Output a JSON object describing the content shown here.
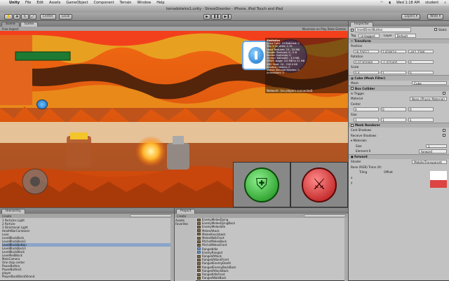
{
  "menubar": {
    "app": "Unity",
    "items": [
      "File",
      "Edit",
      "Assets",
      "GameObject",
      "Component",
      "Terrain",
      "Window",
      "Help"
    ],
    "clock": "Wed 1:18 AM",
    "user": "student"
  },
  "window": {
    "title": "tornadotwins1.unity - StressDisorder - iPhone, iPod Touch and iPad"
  },
  "toolbar": {
    "pivot_label": "Center",
    "space_label": "Local",
    "layers_label": "Layers",
    "layout_label": "Wide"
  },
  "scene_tabs": [
    {
      "label": "Scene"
    },
    {
      "label": "Game"
    }
  ],
  "game_subbar": {
    "left": "Free Aspect",
    "right": "Maximize on Play  Stats  Gizmos"
  },
  "stats_panel": {
    "title": "Statistics",
    "lines": [
      "Draw Calls: 15   Batched: 0",
      "Tris: 2.1k   Verts: 1.7k",
      "Used Textures: 10 - 20 MB",
      "Render Textures: 0 - 0 B",
      "Render Switches: 0",
      "Screen: 640x400 - 3.0 MB",
      "VRAM usage: 3.0 MB to 21 MB",
      "VBO Total: 24 - 218.0 KB",
      "Shadow Casters: 0",
      "Visible Skinned Meshes: 0",
      "Animations: 0"
    ],
    "network": "Network: (no players connected)"
  },
  "hierarchy": {
    "tab": "Hierarchy",
    "create": "Create",
    "items": [
      "1 Particles Light",
      "2 Particle",
      "3 Directional Light",
      "HealthBarContainer",
      "Lava",
      "LevelBlackBack",
      "LevelBlackBack2",
      "LevelBlackButton",
      "LevelBlackBack3",
      "LevelBlackBlock",
      "LevelRedBlock",
      "MainCamera",
      "One stop center",
      "PauseButton",
      "PauseButton2",
      "player",
      "PlayerBackBlockStrand"
    ],
    "selected_index": 7
  },
  "project": {
    "tab": "Project",
    "create": "Create",
    "left_items": [
      "Assets",
      "Favorites"
    ],
    "files": [
      {
        "name": "EnemyMeleeDying",
        "folder": false
      },
      {
        "name": "EnemyMeleeDyingBack",
        "folder": false
      },
      {
        "name": "EnemyMeleeIdle",
        "folder": false
      },
      {
        "name": "MeleeAttack",
        "folder": false
      },
      {
        "name": "MeleeKnockback",
        "folder": false
      },
      {
        "name": "MeleeWalkFront",
        "folder": false
      },
      {
        "name": "PitchstMeleeBack",
        "folder": false
      },
      {
        "name": "PitchstMeleeFront",
        "folder": false
      },
      {
        "name": "RangedIdle",
        "folder": true
      },
      {
        "name": "EnemyRanged",
        "folder": true
      },
      {
        "name": "RangedAttack",
        "folder": false
      },
      {
        "name": "RangedAttackFront",
        "folder": false
      },
      {
        "name": "RangedEnemyDeath",
        "folder": false
      },
      {
        "name": "RangedEnemyBackBack",
        "folder": false
      },
      {
        "name": "RangedAttackBack",
        "folder": false
      },
      {
        "name": "RangedIdleFront",
        "folder": false
      },
      {
        "name": "RangedWalkBack",
        "folder": false
      }
    ]
  },
  "inspector": {
    "tab": "Inspector",
    "object_name": "levelDirectButton",
    "static_label": "Static",
    "tag_label": "Tag",
    "tag_value": "Untagged",
    "layer_label": "Layer",
    "layer_value": "Default",
    "transform": {
      "title": "Transform",
      "position": [
        "18.55612",
        "2.828424",
        "-441.7286"
      ],
      "rotation": [
        "0.01302060",
        "-1.025405",
        "0"
      ],
      "scale": [
        "0.4",
        "1",
        "0"
      ]
    },
    "mesh_filter": {
      "title": "Cube (Mesh Filter)",
      "mesh_label": "Mesh",
      "mesh_value": "Cube"
    },
    "box_collider": {
      "title": "Box Collider",
      "trigger_label": "Is Trigger",
      "material_label": "Material",
      "material_value": "None (Physic Material)",
      "center_label": "Center",
      "center": [
        "0",
        "0",
        "0"
      ],
      "size_label": "Size",
      "size": [
        "1",
        "1",
        "1"
      ]
    },
    "mesh_renderer": {
      "title": "Mesh Renderer",
      "cast_label": "Cast Shadows",
      "receive_label": "Receive Shadows",
      "materials_label": "Materials",
      "size_label": "Size",
      "size_value": "1",
      "element_label": "Element 0",
      "element_value": "forward"
    },
    "material": {
      "title": "forward",
      "shader_label": "Shader",
      "shader_value": "Mobile/Transparent"
    },
    "preview": {
      "title": "Base (RGB) Trans (A)",
      "tiling": "Tiling",
      "offset": "Offset",
      "x_label": "x",
      "y_label": "y"
    }
  },
  "colors": {
    "health_fill": "#22c94b",
    "shield_button": "#2fae2f",
    "attack_button": "#d42323",
    "lava": "#e05a10"
  }
}
